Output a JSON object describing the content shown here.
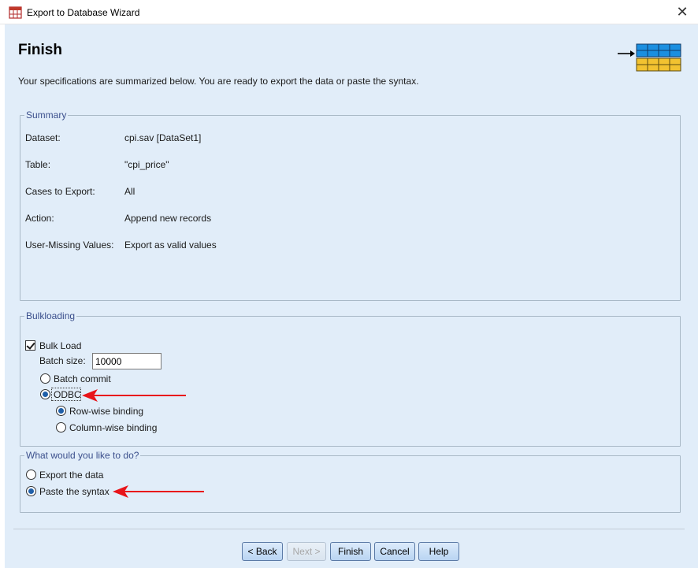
{
  "window": {
    "title": "Export to Database Wizard",
    "close_glyph": "✕"
  },
  "header": {
    "title": "Finish",
    "description": "Your specifications are summarized below. You are ready to export the data or paste the syntax.",
    "icon": "database-table-export-icon"
  },
  "summary": {
    "legend": "Summary",
    "rows": [
      {
        "label": "Dataset:",
        "value": "cpi.sav [DataSet1]"
      },
      {
        "label": "Table:",
        "value": "\"cpi_price\""
      },
      {
        "label": "Cases to Export:",
        "value": "All"
      },
      {
        "label": "Action:",
        "value": "Append new records"
      },
      {
        "label": "User-Missing Values:",
        "value": "Export as valid values"
      }
    ]
  },
  "bulkloading": {
    "legend": "Bulkloading",
    "bulk_load": {
      "label": "Bulk Load",
      "checked": true
    },
    "batch_size": {
      "label": "Batch size:",
      "value": "10000"
    },
    "batch_commit": {
      "label": "Batch commit",
      "selected": false
    },
    "odbc": {
      "label": "ODBC",
      "selected": true
    },
    "row_wise": {
      "label": "Row-wise binding",
      "selected": true
    },
    "column_wise": {
      "label": "Column-wise binding",
      "selected": false
    }
  },
  "action": {
    "legend": "What would you like to do?",
    "export_data": {
      "label": "Export the data",
      "selected": false
    },
    "paste_syntax": {
      "label": "Paste the syntax",
      "selected": true
    }
  },
  "buttons": {
    "back": "< Back",
    "next": "Next >",
    "finish": "Finish",
    "cancel": "Cancel",
    "help": "Help"
  },
  "colors": {
    "dialog_bg": "#e1edf9",
    "legend_text": "#3b4f8c",
    "annotation_arrow": "#e8141a",
    "icon_blue": "#1b8fe0",
    "icon_yellow": "#f2c230"
  }
}
